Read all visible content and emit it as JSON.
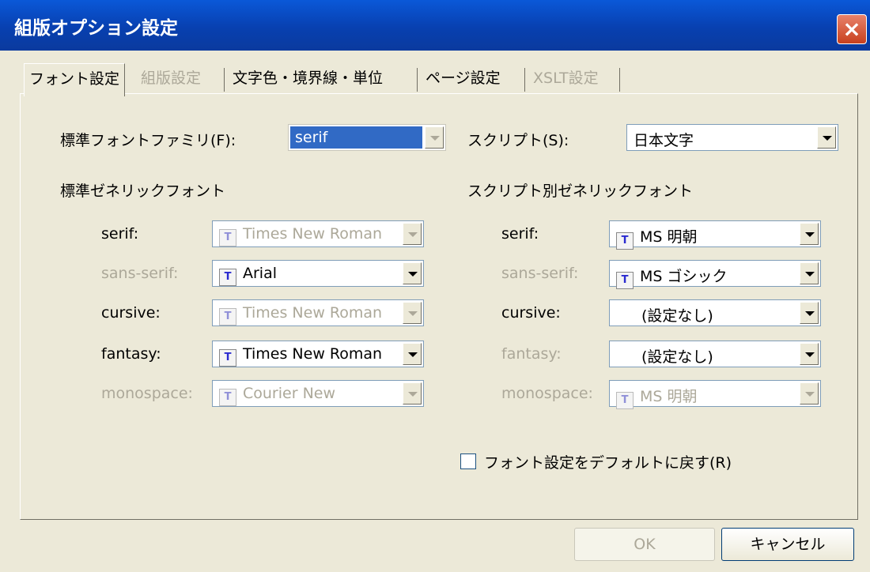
{
  "window": {
    "title": "組版オプション設定",
    "close_label": "×"
  },
  "tabs": [
    {
      "label": "フォント設定",
      "active": true,
      "enabled": true
    },
    {
      "label": "組版設定",
      "active": false,
      "enabled": false
    },
    {
      "label": "文字色・境界線・単位",
      "active": false,
      "enabled": true
    },
    {
      "label": "ページ設定",
      "active": false,
      "enabled": true
    },
    {
      "label": "XSLT設定",
      "active": false,
      "enabled": false
    }
  ],
  "standard_family": {
    "label": "標準フォントファミリ(F):",
    "value": "serif"
  },
  "script": {
    "label": "スクリプト(S):",
    "value": "日本文字"
  },
  "standard_generic": {
    "heading": "標準ゼネリックフォント",
    "rows": [
      {
        "label": "serif:",
        "value": "Times New Roman",
        "enabled": false
      },
      {
        "label": "sans-serif:",
        "value": "Arial",
        "enabled": true
      },
      {
        "label": "cursive:",
        "value": "Times New Roman",
        "enabled": false
      },
      {
        "label": "fantasy:",
        "value": "Times New Roman",
        "enabled": true
      },
      {
        "label": "monospace:",
        "value": "Courier New",
        "enabled": false
      }
    ]
  },
  "script_generic": {
    "heading": "スクリプト別ゼネリックフォント",
    "rows": [
      {
        "label": "serif:",
        "value": "MS 明朝",
        "enabled": true
      },
      {
        "label": "sans-serif:",
        "value": "MS ゴシック",
        "enabled": true
      },
      {
        "label": "cursive:",
        "value": "(設定なし)",
        "enabled": true
      },
      {
        "label": "fantasy:",
        "value": "(設定なし)",
        "enabled": true
      },
      {
        "label": "monospace:",
        "value": "MS 明朝",
        "enabled": false
      }
    ]
  },
  "reset_checkbox": {
    "label": "フォント設定をデフォルトに戻す(R)",
    "checked": false
  },
  "buttons": {
    "ok": "OK",
    "cancel": "キャンセル"
  },
  "icons": {
    "font_icon_glyph": "T"
  }
}
